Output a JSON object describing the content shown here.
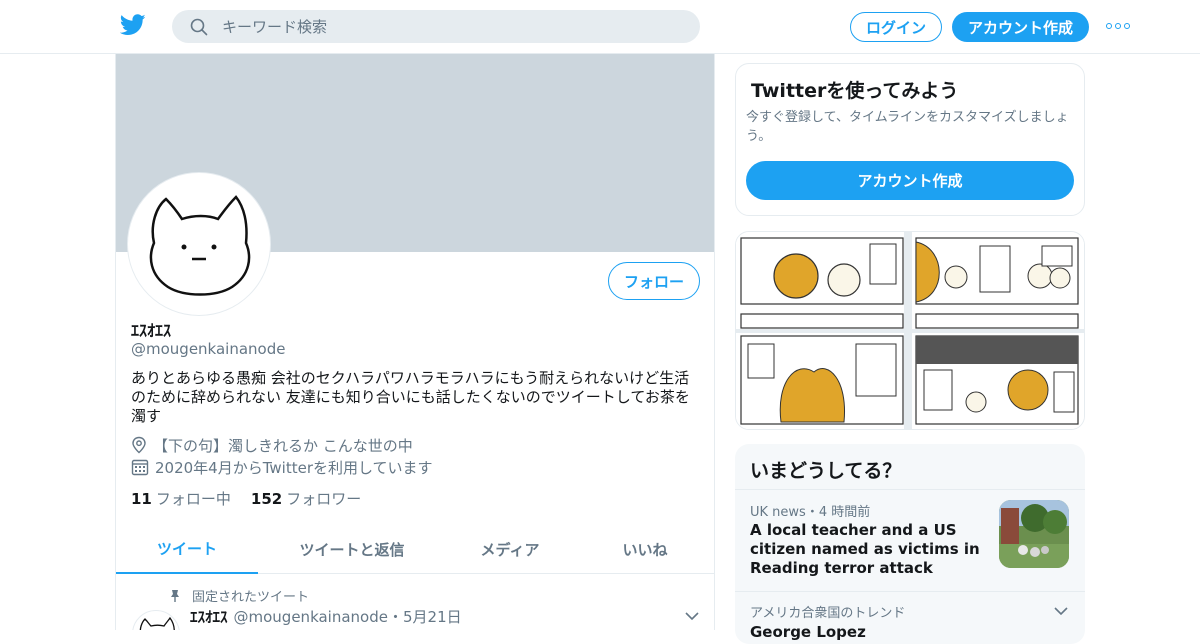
{
  "header": {
    "search_placeholder": "キーワード検索",
    "login_label": "ログイン",
    "signup_label": "アカウント作成",
    "accent_color": "#1da1f2"
  },
  "profile": {
    "display_name": "ｴｽｵｴｽ",
    "handle": "@mougenkainanode",
    "bio": "ありとあらゆる愚痴 会社のセクハラパワハラモラハラにもう耐えられないけど生活のために辞められない 友達にも知り合いにも話したくないのでツイートしてお茶を濁す",
    "location": "【下の句】濁しきれるか こんな世の中",
    "joined": "2020年4月からTwitterを利用しています",
    "following_count": "11",
    "following_label": "フォロー中",
    "followers_count": "152",
    "followers_label": "フォロワー",
    "follow_button": "フォロー"
  },
  "tabs": [
    {
      "label": "ツイート",
      "active": true
    },
    {
      "label": "ツイートと返信",
      "active": false
    },
    {
      "label": "メディア",
      "active": false
    },
    {
      "label": "いいね",
      "active": false
    }
  ],
  "pinned_tweet": {
    "pinned_label": "固定されたツイート",
    "name": "ｴｽｵｴｽ",
    "handle": "@mougenkainanode",
    "separator": "・",
    "date": "5月21日"
  },
  "sidebar": {
    "signup_card": {
      "title": "Twitterを使ってみよう",
      "description": "今すぐ登録して、タイムラインをカスタマイズしましょう。",
      "button": "アカウント作成"
    },
    "trends": {
      "title": "いまどうしてる？",
      "items": [
        {
          "source": "UK news",
          "separator": "・",
          "time": "4 時間前",
          "headline": "A local teacher and a US citizen named as victims in Reading terror attack"
        },
        {
          "context": "アメリカ合衆国のトレンド",
          "name": "George Lopez"
        }
      ]
    }
  }
}
